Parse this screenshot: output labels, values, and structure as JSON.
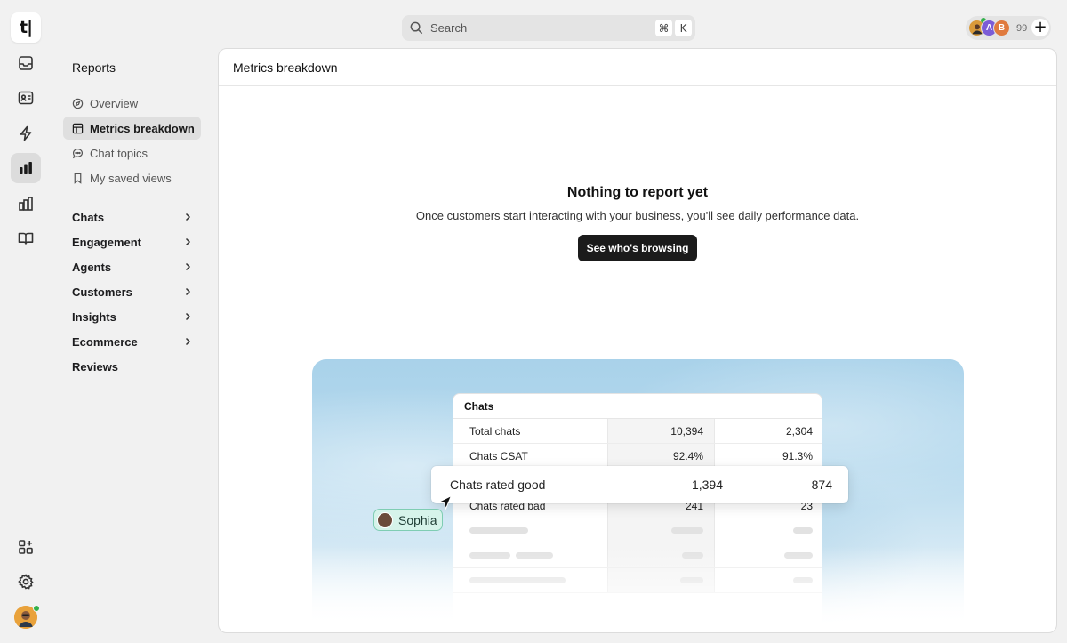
{
  "app": {
    "logo_text": "t|"
  },
  "rail": {
    "items": [
      {
        "icon": "inbox-icon"
      },
      {
        "icon": "contacts-icon"
      },
      {
        "icon": "automation-bolt-icon"
      },
      {
        "icon": "reports-chart-icon",
        "active": true
      },
      {
        "icon": "analytics-icon"
      },
      {
        "icon": "knowledge-book-icon"
      }
    ],
    "bottom": [
      {
        "icon": "apps-grid-icon"
      },
      {
        "icon": "settings-gear-icon"
      }
    ],
    "user_status": "online"
  },
  "topbar": {
    "search_placeholder": "Search",
    "shortcut_key1": "⌘",
    "shortcut_key2": "K",
    "avatar_letters": [
      "",
      "A",
      "B"
    ],
    "avatar_count": "99",
    "add_label": "+"
  },
  "subnav": {
    "title": "Reports",
    "items": [
      {
        "label": "Overview",
        "icon": "compass-icon"
      },
      {
        "label": "Metrics breakdown",
        "icon": "table-icon",
        "active": true
      },
      {
        "label": "Chat topics",
        "icon": "chat-bubble-icon"
      },
      {
        "label": "My saved views",
        "icon": "bookmark-icon"
      }
    ],
    "groups": [
      {
        "label": "Chats",
        "has_children": true
      },
      {
        "label": "Engagement",
        "has_children": true
      },
      {
        "label": "Agents",
        "has_children": true
      },
      {
        "label": "Customers",
        "has_children": true
      },
      {
        "label": "Insights",
        "has_children": true
      },
      {
        "label": "Ecommerce",
        "has_children": true
      },
      {
        "label": "Reviews",
        "has_children": false
      }
    ]
  },
  "main": {
    "header_title": "Metrics breakdown",
    "empty_title": "Nothing to report yet",
    "empty_description": "Once customers start interacting with your business, you'll see daily performance data.",
    "cta_label": "See who's browsing"
  },
  "illustration": {
    "table_title": "Chats",
    "rows": [
      {
        "label": "Total chats",
        "v1": "10,394",
        "v2": "2,304"
      },
      {
        "label": "Chats CSAT",
        "v1": "92.4%",
        "v2": "91.3%"
      },
      {
        "label": "Chats rated bad",
        "v1": "241",
        "v2": "23"
      }
    ],
    "highlight": {
      "label": "Chats rated good",
      "v1": "1,394",
      "v2": "874"
    },
    "cursor_name": "Sophia"
  }
}
